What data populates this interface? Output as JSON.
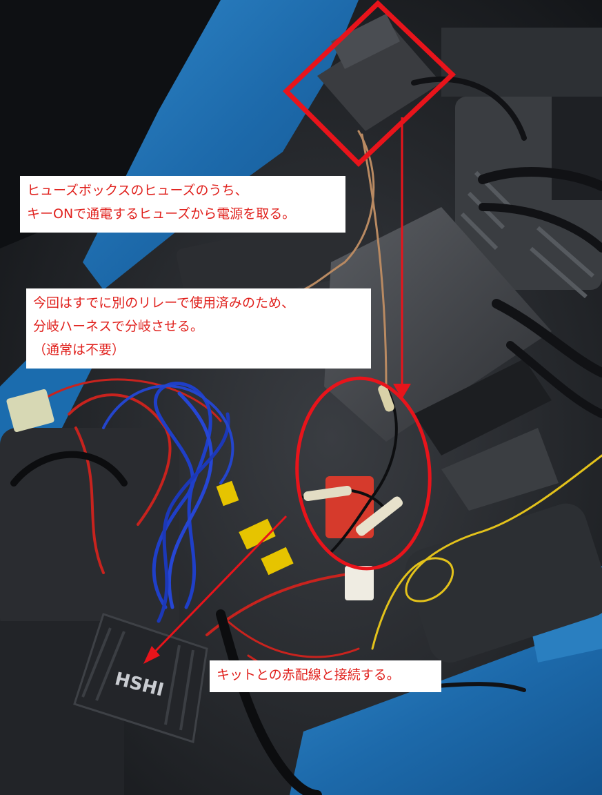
{
  "annotations": {
    "fuse_note": {
      "lines": [
        "ヒューズボックスのヒューズのうち、",
        "キーONで通電するヒューズから電源を取る。"
      ]
    },
    "branch_note": {
      "lines": [
        "今回はすでに別のリレーで使用済みのため、",
        "分岐ハーネスで分岐させる。",
        "（通常は不要）"
      ]
    },
    "kit_note": {
      "lines": [
        "キットとの赤配線と接続する。"
      ]
    }
  },
  "device_label": "HSHI",
  "colors": {
    "annotation_red": "#e8141b",
    "text_red": "#e0201c",
    "panel_blue": "#1e6fb0",
    "wire_blue": "#1f3fc8"
  }
}
